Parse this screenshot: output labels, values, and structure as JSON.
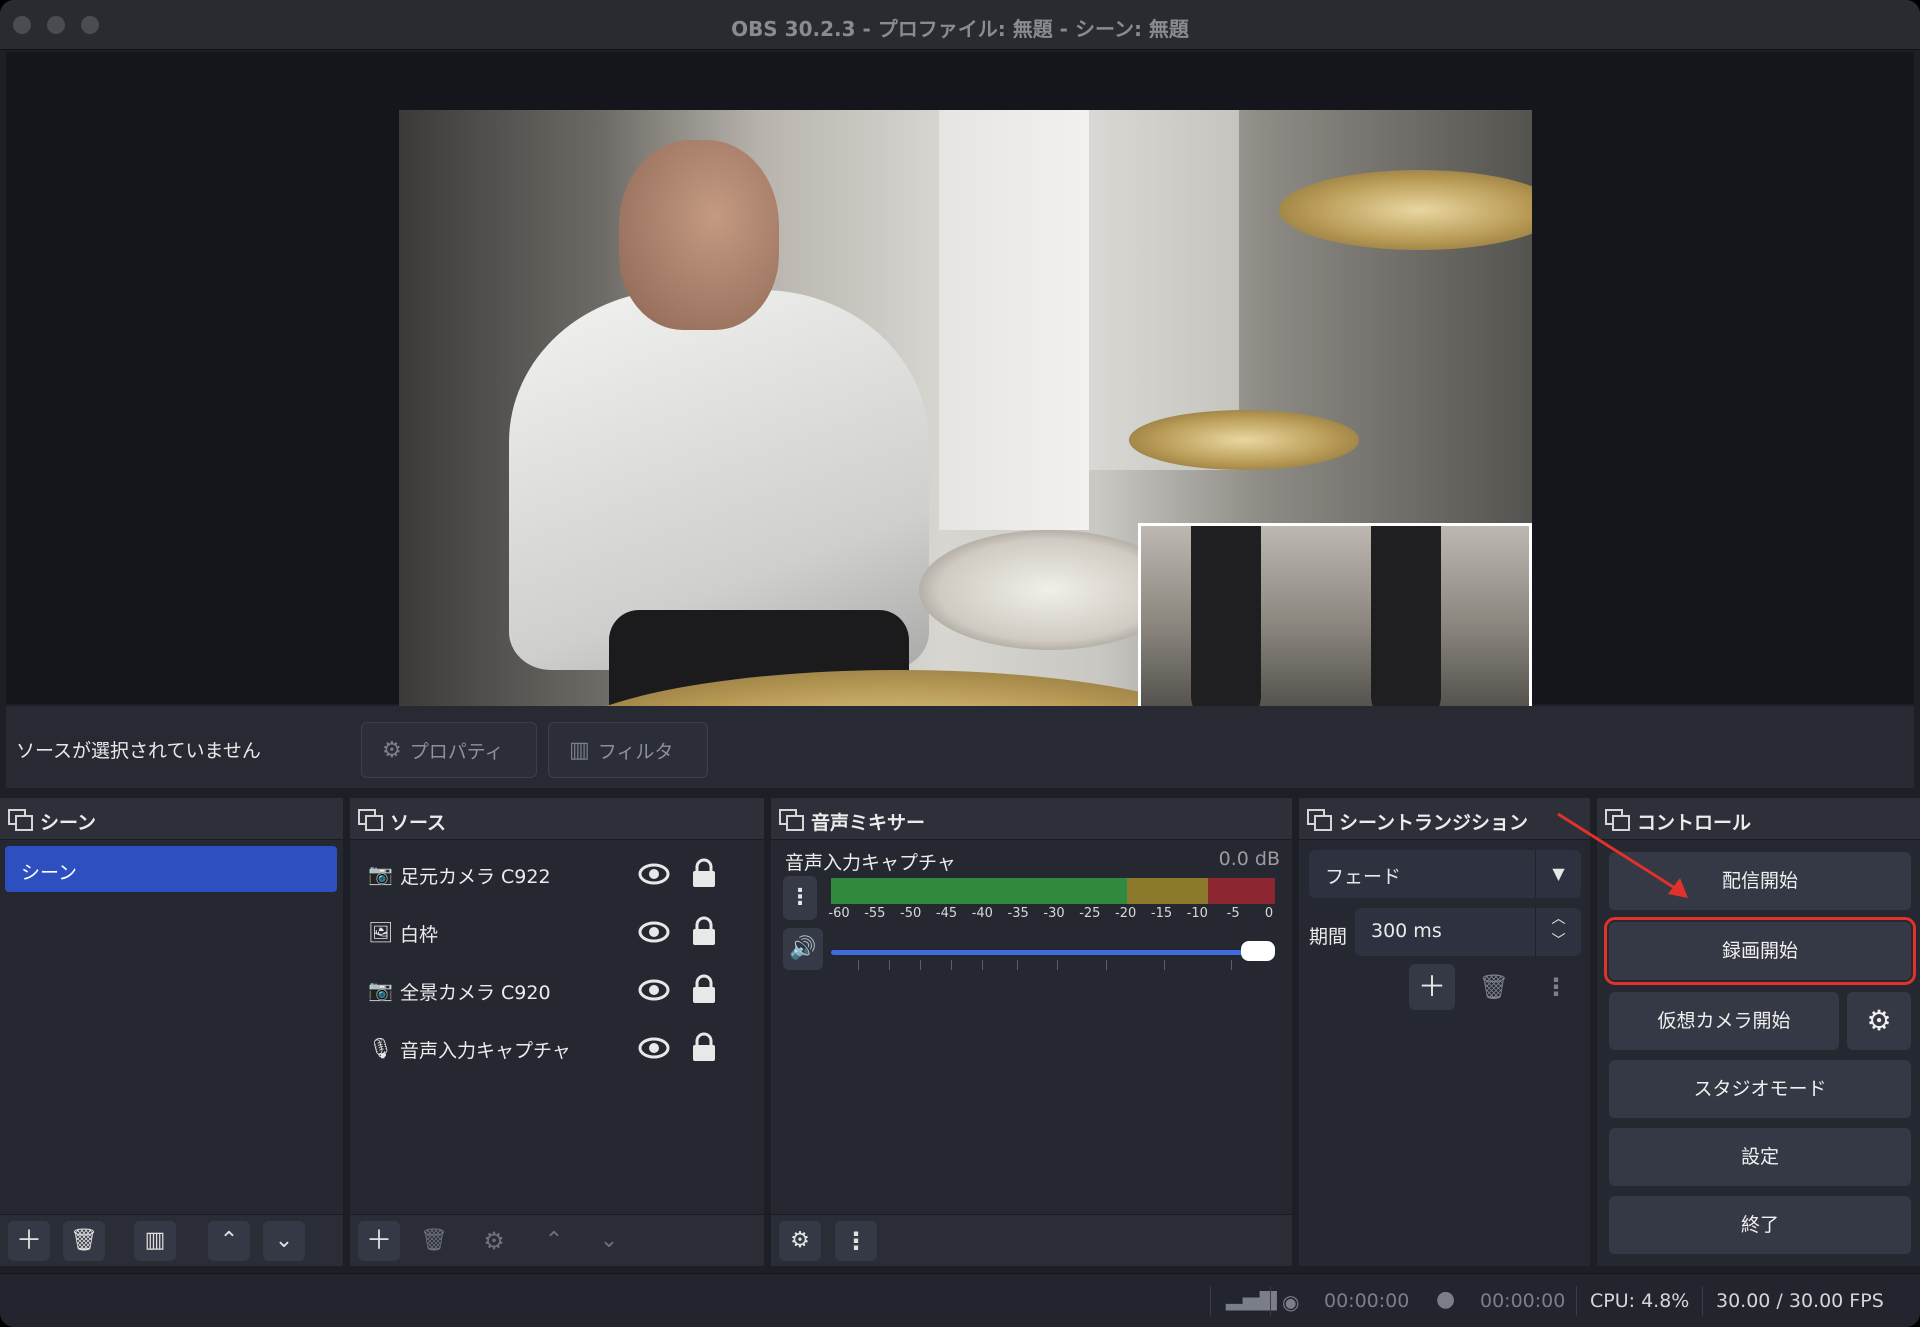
{
  "window": {
    "title": "OBS 30.2.3 - プロファイル: 無題 - シーン: 無題"
  },
  "selection": {
    "message": "ソースが選択されていません",
    "properties_label": "プロパティ",
    "filters_label": "フィルタ"
  },
  "scenes": {
    "title": "シーン",
    "items": [
      {
        "label": "シーン",
        "selected": true
      }
    ]
  },
  "sources": {
    "title": "ソース",
    "items": [
      {
        "label": "足元カメラ C922",
        "icon": "camera-icon"
      },
      {
        "label": "白枠",
        "icon": "image-icon"
      },
      {
        "label": "全景カメラ C920",
        "icon": "camera-icon"
      },
      {
        "label": "音声入力キャプチャ",
        "icon": "microphone-icon"
      }
    ]
  },
  "mixer": {
    "title": "音声ミキサー",
    "channel": {
      "name": "音声入力キャプチャ",
      "db": "0.0 dB",
      "volume": 1.0,
      "scale": [
        "-60",
        "-55",
        "-50",
        "-45",
        "-40",
        "-35",
        "-30",
        "-25",
        "-20",
        "-15",
        "-10",
        "-5",
        "0"
      ]
    }
  },
  "transitions": {
    "title": "シーントランジション",
    "selected": "フェード",
    "duration_label": "期間",
    "duration_value": "300 ms"
  },
  "controls": {
    "title": "コントロール",
    "start_streaming": "配信開始",
    "start_recording": "録画開始",
    "start_virtual_camera": "仮想カメラ開始",
    "studio_mode": "スタジオモード",
    "settings": "設定",
    "exit": "終了"
  },
  "status": {
    "stream_time": "00:00:00",
    "record_time": "00:00:00",
    "cpu": "CPU: 4.8%",
    "fps": "30.00 / 30.00 FPS"
  },
  "colors": {
    "accent": "#2e4fbf",
    "highlight": "#e0322a"
  }
}
